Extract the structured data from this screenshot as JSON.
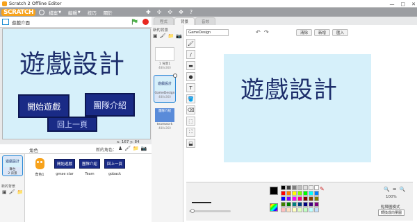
{
  "window": {
    "title": "Scratch 2 Offline Editor",
    "controls": [
      "—",
      "□",
      "✕"
    ]
  },
  "menubar": {
    "logo": "SCRATCH",
    "menus": [
      "檔案",
      "編輯",
      "技巧",
      "關於"
    ],
    "tools": [
      "✚",
      "✢",
      "✣",
      "✥",
      "?"
    ]
  },
  "stage": {
    "project_title": "遊戲介面",
    "big_title": "遊戲設計",
    "btn_start": "開始遊戲",
    "btn_team": "團隊介紹",
    "btn_behind": "回上一頁",
    "coords": "x: 167  y: 84"
  },
  "sprites": {
    "header_label": "角色",
    "new_sprite_label": "新的角色：",
    "new_sprite_tools": [
      "♟",
      "🖌",
      "📁",
      "📷"
    ],
    "stage_thumb": {
      "mini_text": "遊戲設計",
      "caption": "舞台",
      "sub": "2 背景"
    },
    "new_backdrop_label": "新的背景",
    "backdrop_tools": [
      "▣",
      "🖌",
      "📁",
      "📷"
    ],
    "items": [
      {
        "name": "角色1",
        "kind": "cat"
      },
      {
        "name": "gmae star",
        "kind": "btn",
        "text": "開始遊戲"
      },
      {
        "name": "Team",
        "kind": "btn",
        "text": "團隊介紹"
      },
      {
        "name": "goback",
        "kind": "btn",
        "text": "回上一頁"
      }
    ]
  },
  "tabs": [
    "程式",
    "背景",
    "音效"
  ],
  "backdrop_panel": {
    "new_label": "新的背景",
    "tools": [
      "▣",
      "🖌",
      "📁",
      "📷"
    ],
    "items": [
      {
        "index": "1",
        "name": "背景1",
        "size": "480x360"
      },
      {
        "index": "2",
        "name": "GameDesign",
        "size": "480x360"
      },
      {
        "index": "3",
        "name": "teamwork",
        "size": "480x360"
      }
    ]
  },
  "editor": {
    "costume_name": "GameDesign",
    "undo": "↶",
    "redo": "↷",
    "buttons": [
      "清除",
      "新增",
      "匯入"
    ],
    "canvas_title": "遊戲設計",
    "zoom_level": "100%",
    "mode_label": "點陣圖模式",
    "mode_button": "轉換成向量圖",
    "tools": [
      "🖌",
      "/",
      "▬",
      "●",
      "T",
      "🪣",
      "⌫",
      "⬚",
      "⛶",
      "⬓"
    ]
  },
  "palette_colors": [
    "#000000",
    "#3f3f3f",
    "#7f7f7f",
    "#bfbfbf",
    "#dfdfdf",
    "#efefef",
    "#ffffff",
    "#ff0000",
    "#ff7f00",
    "#ffff00",
    "#7fff00",
    "#00ff00",
    "#00ffff",
    "#007fff",
    "#0000ff",
    "#7f00ff",
    "#ff00ff",
    "#ff007f",
    "#7f0000",
    "#7f3f00",
    "#7f7f00",
    "#3f7f00",
    "#007f00",
    "#007f7f",
    "#003f7f",
    "#00007f",
    "#3f007f",
    "#7f007f",
    "#ffbfbf",
    "#ffdfbf",
    "#ffffbf",
    "#dfffbf",
    "#bfffbf",
    "#bfffff",
    "#bfdfff"
  ]
}
